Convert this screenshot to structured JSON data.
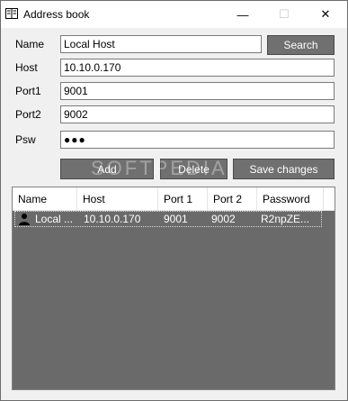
{
  "window": {
    "title": "Address book",
    "min": "—",
    "max": "☐",
    "close": "✕"
  },
  "form": {
    "name_label": "Name",
    "name_value": "Local Host",
    "search_label": "Search",
    "host_label": "Host",
    "host_value": "10.10.0.170",
    "port1_label": "Port1",
    "port1_value": "9001",
    "port2_label": "Port2",
    "port2_value": "9002",
    "psw_label": "Psw",
    "psw_value": "●●●"
  },
  "actions": {
    "add": "Add",
    "delete": "Delete",
    "save": "Save changes"
  },
  "list": {
    "columns": [
      "Name",
      "Host",
      "Port 1",
      "Port 2",
      "Password"
    ],
    "rows": [
      {
        "name": "Local ...",
        "host": "10.10.0.170",
        "port1": "9001",
        "port2": "9002",
        "password": "R2npZE..."
      }
    ]
  },
  "watermark": "SOFTPEDIA",
  "icons": {
    "app": "address-book-icon",
    "user": "user-icon"
  }
}
